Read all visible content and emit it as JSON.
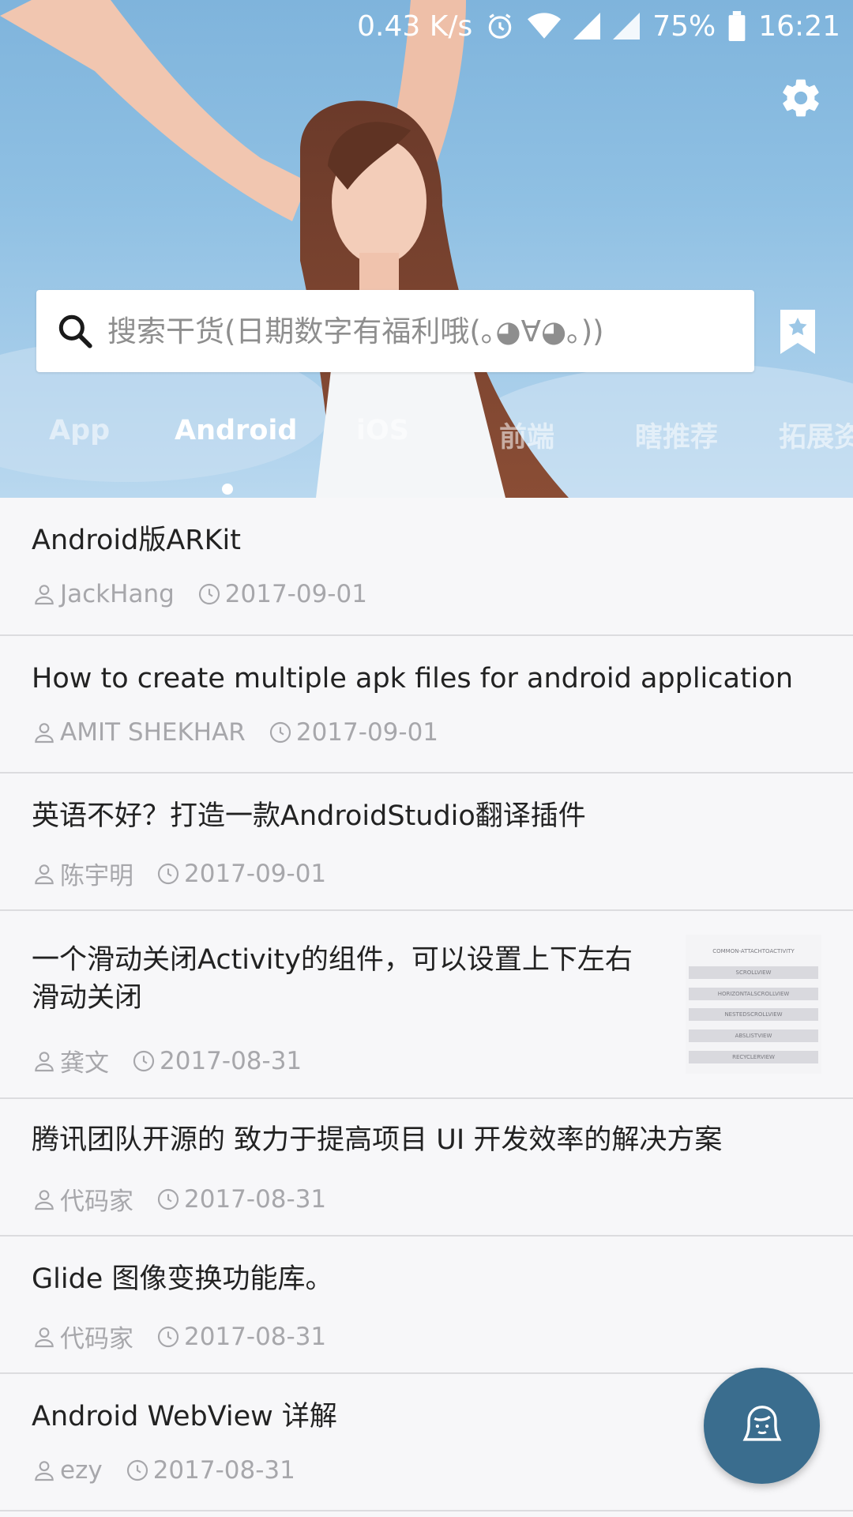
{
  "status_bar": {
    "net_speed": "0.43 K/s",
    "battery": "75%",
    "time": "16:21",
    "icons": [
      "alarm-icon",
      "wifi-icon",
      "signal-icon",
      "signal-icon-2",
      "battery-icon"
    ]
  },
  "header": {
    "settings_icon": "gear-icon",
    "bookmark_icon": "bookmark-star-icon",
    "search": {
      "placeholder": "搜索干货(日期数字有福利哦(｡◕∀◕｡))",
      "value": ""
    }
  },
  "tabs": {
    "items": [
      {
        "label": "App"
      },
      {
        "label": "Android"
      },
      {
        "label": "iOS"
      },
      {
        "label": "前端"
      },
      {
        "label": "瞎推荐"
      },
      {
        "label": "拓展资"
      }
    ],
    "active": "Android"
  },
  "list": {
    "items": [
      {
        "title": "Android版ARKit",
        "author": "JackHang",
        "date": "2017-09-01"
      },
      {
        "title": "How to create multiple apk files for android application",
        "author": "AMIT SHEKHAR",
        "date": "2017-09-01"
      },
      {
        "title": "英语不好？打造一款AndroidStudio翻译插件",
        "author": "陈宇明",
        "date": "2017-09-01"
      },
      {
        "title_line1": "一个滑动关闭Activity的组件，可以设置上下左右",
        "title_line2": "滑动关闭",
        "author": "龚文",
        "date": "2017-08-31",
        "thumbnail_rows": [
          "COMMON-ATTACHTOACTIVITY",
          "SCROLLVIEW",
          "HORIZONTALSCROLLVIEW",
          "NESTEDSCROLLVIEW",
          "ABSLISTVIEW",
          "RECYCLERVIEW"
        ]
      },
      {
        "title": "腾讯团队开源的 致力于提高项目 UI 开发效率的解决方案",
        "author": "代码家",
        "date": "2017-08-31"
      },
      {
        "title": "Glide 图像变换功能库。",
        "author": "代码家",
        "date": "2017-08-31"
      },
      {
        "title": "Android WebView 详解",
        "author": "ezy",
        "date": "2017-08-31"
      }
    ]
  },
  "fab": {
    "icon": "girl-face-icon"
  },
  "colors": {
    "fab": "#3a6d8e",
    "meta_text": "#a7a7ab",
    "title_text": "#222222",
    "sky": "#8fc0e3"
  }
}
